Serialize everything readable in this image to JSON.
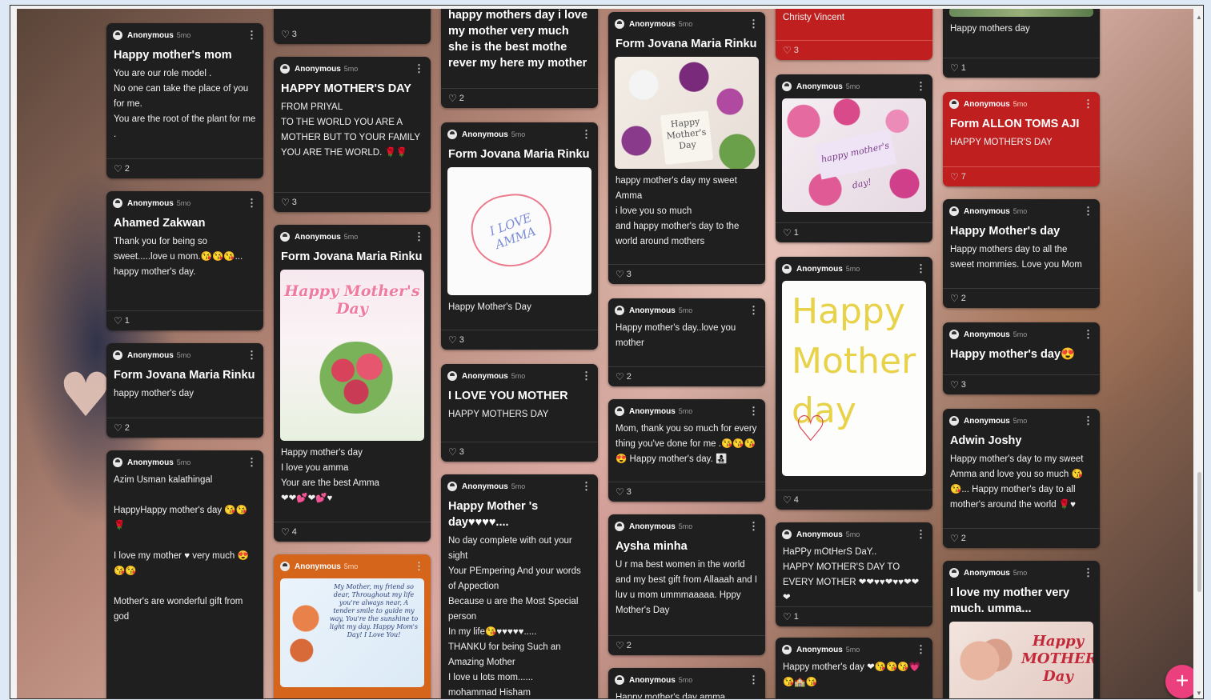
{
  "colors": {
    "card": "#1f1f1f",
    "card_red": "#bf1f1f",
    "card_orange": "#d4651b",
    "fab": "#ec3f7d"
  },
  "icons": {
    "heart": "heart-icon",
    "menu": "kebab-menu-icon",
    "add": "plus-icon",
    "avatar": "anonymous-avatar-icon"
  },
  "fab": {
    "label": "+"
  },
  "posts": [
    {
      "author": "Anonymous",
      "time": "5mo",
      "title": "Happy mother's mom",
      "body": "You are our role model .\nNo one can take the place of you for me.\nYou are the root of the plant for me .",
      "likes": "2"
    },
    {
      "author": "Anonymous",
      "time": "5mo",
      "title": "Ahamed Zakwan",
      "body": "Thank you for being so sweet.....love u mom.😘😘😘...\nhappy mother's day.",
      "likes": "1"
    },
    {
      "author": "Anonymous",
      "time": "5mo",
      "title": "Form Jovana Maria Rinku",
      "body": "happy mother's day",
      "likes": "2"
    },
    {
      "author": "Anonymous",
      "time": "5mo",
      "title": "",
      "body": "Azim Usman kalathingal\n\nHappyHappy mother's day 😘😘🌹\n\nI love my mother ♥ very much 😍😘😘\n\nMother's are wonderful gift from god",
      "likes": ""
    },
    {
      "author": "",
      "time": "",
      "title": "",
      "body": "",
      "likes": "3"
    },
    {
      "author": "Anonymous",
      "time": "5mo",
      "title": "HAPPY MOTHER'S DAY",
      "body": "FROM PRIYAL\nTO THE WORLD YOU ARE A MOTHER BUT TO YOUR FAMILY YOU ARE THE WORLD. 🌹🌹",
      "likes": "3"
    },
    {
      "author": "Anonymous",
      "time": "5mo",
      "title": "Form Jovana Maria Rinku",
      "image": "Happy Mother's Day",
      "body": "Happy mother's day\nI love you amma\nYour are the best Amma\n❤❤💕❤💕♥",
      "likes": "4"
    },
    {
      "author": "Anonymous",
      "time": "5mo",
      "title": "",
      "image": "My Mother, my friend so dear, Throughout my life you're always near, A tender smile to guide my way, You're the sunshine to light my day. Happy Mom's Day! I Love You!",
      "body": "",
      "likes": ""
    },
    {
      "author": "",
      "time": "",
      "title": "happy mothers day i love my mother very much she is the best mothe rever my here my mother",
      "body": "",
      "likes": "2"
    },
    {
      "author": "Anonymous",
      "time": "5mo",
      "title": "Form Jovana Maria Rinku",
      "image": "I LOVE AMMA",
      "body": "Happy Mother's Day",
      "likes": "3"
    },
    {
      "author": "Anonymous",
      "time": "5mo",
      "title": "I LOVE YOU MOTHER",
      "body": "HAPPY MOTHERS DAY",
      "likes": "3"
    },
    {
      "author": "Anonymous",
      "time": "5mo",
      "title": "Happy Mother 's day♥♥♥♥....",
      "body": "No day complete with out your sight\nYour PEmpering And your words of Appection\nBecause u are the Most Special person\nIn my life😘♥♥♥♥♥.....\nTHANKU for being Such an Amazing Mother\nI love u lots mom......\nmohammad Hisham",
      "likes": ""
    },
    {
      "author": "Anonymous",
      "time": "5mo",
      "title": "Form Jovana Maria Rinku",
      "image": "Happy Mother's Day",
      "body": "happy mother's day my sweet Amma\ni love you so much\nand happy mother's day to the world around mothers",
      "likes": "3"
    },
    {
      "author": "Anonymous",
      "time": "5mo",
      "title": "",
      "body": "Happy mother's day..love you mother",
      "likes": "2"
    },
    {
      "author": "Anonymous",
      "time": "5mo",
      "title": "",
      "body": "Mom, thank you so much for every thing you've done for me .😘😘😘😍 Happy mother's day. 👩‍👧‍👦",
      "likes": "3"
    },
    {
      "author": "Anonymous",
      "time": "5mo",
      "title": "Aysha minha",
      "body": "U r ma best women in the world and my best gift from Allaaah and I luv u mom ummmaaaaa. Hppy Mother's Day",
      "likes": "2"
    },
    {
      "author": "Anonymous",
      "time": "5mo",
      "title": "",
      "body": "Happy mother's day amma",
      "likes": ""
    },
    {
      "author": "",
      "time": "",
      "title": "",
      "body": "Christy Vincent",
      "likes": "3"
    },
    {
      "author": "Anonymous",
      "time": "5mo",
      "title": "",
      "image": "happy mother's day!",
      "body": "",
      "likes": "1"
    },
    {
      "author": "Anonymous",
      "time": "5mo",
      "title": "",
      "image": "Happy Mother day",
      "body": "",
      "likes": "4"
    },
    {
      "author": "Anonymous",
      "time": "5mo",
      "title": "",
      "body": "HaPPy mOtHerS DaY..\nHAPPY MOTHER'S DAY TO EVERY MOTHER ❤❤♥♥❤♥♥❤❤❤",
      "likes": "1"
    },
    {
      "author": "Anonymous",
      "time": "5mo",
      "title": "",
      "body": "Happy mother's day ❤😘😘😘💗😘🏫😘",
      "likes": ""
    },
    {
      "author": "",
      "time": "",
      "title": "",
      "body": "Happy mothers day",
      "likes": "1"
    },
    {
      "author": "Anonymous",
      "time": "5mo",
      "title": "Form ALLON TOMS AJI",
      "body": "HAPPY  MOTHER'S DAY",
      "likes": "7"
    },
    {
      "author": "Anonymous",
      "time": "5mo",
      "title": "Happy Mother's day",
      "body": "Happy mothers day to all the sweet mommies. Love you Mom",
      "likes": "2"
    },
    {
      "author": "Anonymous",
      "time": "5mo",
      "title": "Happy mother's day😍",
      "body": "",
      "likes": "3"
    },
    {
      "author": "Anonymous",
      "time": "5mo",
      "title": "Adwin Joshy",
      "body": "Happy mother's day to my sweet Amma and love you so much 😘😘... Happy mother's day to all mother's around the world 🌹♥",
      "likes": "2"
    },
    {
      "author": "Anonymous",
      "time": "5mo",
      "title": "I love my mother very much. umma...",
      "image": "Happy MOTHER'S Day",
      "body": "",
      "likes": ""
    }
  ]
}
